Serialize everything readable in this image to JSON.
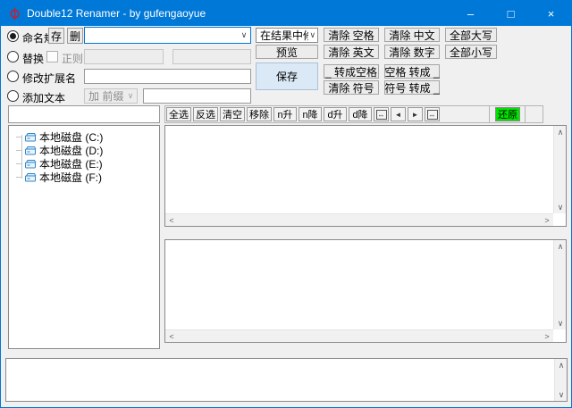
{
  "window": {
    "title": "Double12 Renamer - by gufengaoyue",
    "minimize": "–",
    "maximize": "□",
    "close": "×"
  },
  "colors": {
    "titlebar": "#0078d7",
    "focus_border": "#0078d7",
    "save_button_bg": "#dbe9f7",
    "restore_button_bg": "#00e300",
    "client_bg": "#f0f0f0"
  },
  "rules": {
    "rename": {
      "label": "命名规则",
      "save": "存",
      "del": "删",
      "pattern_value": ""
    },
    "replace": {
      "label": "替换",
      "regex": "正则",
      "find_value": "",
      "with_value": ""
    },
    "extension": {
      "label": "修改扩展名",
      "value": ""
    },
    "addtext": {
      "label": "添加文本",
      "mode": "加 前缀",
      "value": ""
    }
  },
  "actions": {
    "target_mode": "在结果中修改",
    "preview": "预览",
    "save": "保存",
    "col1": [
      "清除 空格",
      "清除 英文",
      "_ 转成空格",
      "清除 符号"
    ],
    "col2": [
      "清除 中文",
      "清除 数字",
      "空格 转成 _",
      "符号 转成 _"
    ],
    "col3": [
      "全部大写",
      "全部小写"
    ]
  },
  "toolbar": {
    "buttons": [
      "全选",
      "反选",
      "清空",
      "移除",
      "n升",
      "n降",
      "d升",
      "d降"
    ],
    "nav_first": "↔",
    "nav_prev": "◄",
    "nav_next": "►",
    "nav_last": "↔",
    "restore": "还原"
  },
  "sidebar": {
    "filter_value": "",
    "drives": [
      "本地磁盘 (C:)",
      "本地磁盘 (D:)",
      "本地磁盘 (E:)",
      "本地磁盘 (F:)"
    ]
  },
  "icons": {
    "scroll_up": "∧",
    "scroll_down": "∨",
    "scroll_left": "<",
    "scroll_right": ">",
    "chevron_down": "∨"
  }
}
